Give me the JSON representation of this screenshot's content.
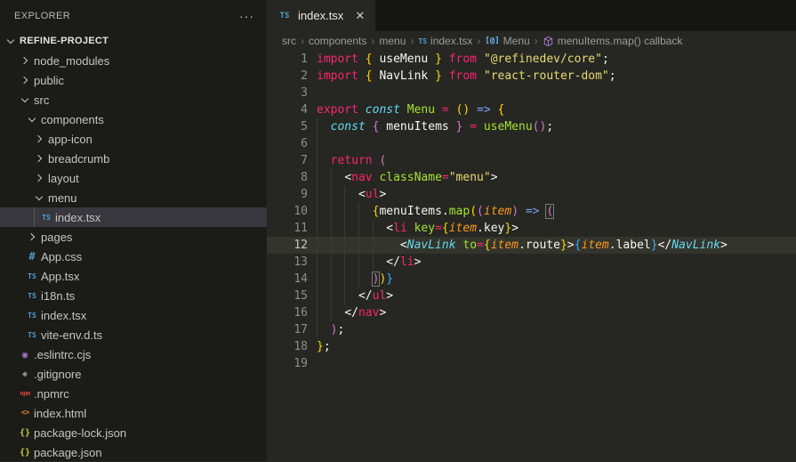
{
  "colors": {
    "editor_bg": "#262722",
    "sidebar_bg": "#1b1b18",
    "tabstrip_bg": "#161612",
    "selection_bg": "#37373d",
    "active_line_bg": "#33342c",
    "keyword": "#f92672",
    "entity": "#a6e22e",
    "type_italic": "#66d9ef",
    "param_italic": "#fd971f",
    "string": "#e6db74",
    "foreground": "#f8f8f2",
    "bracket1": "#ffd700",
    "bracket2": "#da70d6",
    "bracket3": "#3fa9ff",
    "ts_icon": "#4f9fd1"
  },
  "explorer": {
    "title": "EXPLORER",
    "more_label": "···",
    "root_label": "REFINE-PROJECT",
    "items": [
      {
        "label": "node_modules",
        "type": "folder",
        "state": "collapsed",
        "level": 1
      },
      {
        "label": "public",
        "type": "folder",
        "state": "collapsed",
        "level": 1
      },
      {
        "label": "src",
        "type": "folder",
        "state": "expanded",
        "level": 1
      },
      {
        "label": "components",
        "type": "folder",
        "state": "expanded",
        "level": 2
      },
      {
        "label": "app-icon",
        "type": "folder",
        "state": "collapsed",
        "level": 3
      },
      {
        "label": "breadcrumb",
        "type": "folder",
        "state": "collapsed",
        "level": 3
      },
      {
        "label": "layout",
        "type": "folder",
        "state": "collapsed",
        "level": 3
      },
      {
        "label": "menu",
        "type": "folder",
        "state": "expanded",
        "level": 3
      },
      {
        "label": "index.tsx",
        "type": "file",
        "icon": "ts",
        "level": 4,
        "selected": true
      },
      {
        "label": "pages",
        "type": "folder",
        "state": "collapsed",
        "level": 2
      },
      {
        "label": "App.css",
        "type": "file",
        "icon": "css",
        "level": 2
      },
      {
        "label": "App.tsx",
        "type": "file",
        "icon": "ts",
        "level": 2
      },
      {
        "label": "i18n.ts",
        "type": "file",
        "icon": "ts",
        "level": 2
      },
      {
        "label": "index.tsx",
        "type": "file",
        "icon": "ts",
        "level": 2
      },
      {
        "label": "vite-env.d.ts",
        "type": "file",
        "icon": "ts",
        "level": 2
      },
      {
        "label": ".eslintrc.cjs",
        "type": "file",
        "icon": "eslint",
        "level": 1
      },
      {
        "label": ".gitignore",
        "type": "file",
        "icon": "git",
        "level": 1
      },
      {
        "label": ".npmrc",
        "type": "file",
        "icon": "npm",
        "level": 1
      },
      {
        "label": "index.html",
        "type": "file",
        "icon": "html",
        "level": 1
      },
      {
        "label": "package-lock.json",
        "type": "file",
        "icon": "json",
        "level": 1
      },
      {
        "label": "package.json",
        "type": "file",
        "icon": "json",
        "level": 1
      }
    ],
    "file_icon_glyphs": {
      "ts": "TS",
      "css": "#",
      "json": "{}",
      "html": "<>",
      "eslint": "◉",
      "git": "◆",
      "npm": "npm"
    }
  },
  "tab": {
    "icon": "TS",
    "title": "index.tsx",
    "close": "✕"
  },
  "breadcrumb": {
    "separator": "›",
    "items": [
      {
        "label": "src"
      },
      {
        "label": "components"
      },
      {
        "label": "menu"
      },
      {
        "label": "index.tsx",
        "icon": "ts"
      },
      {
        "label": "Menu",
        "icon": "symbol-variable"
      },
      {
        "label": "menuItems.map() callback",
        "icon": "symbol-method"
      }
    ]
  },
  "editor": {
    "lines": [
      {
        "n": 1,
        "tokens": [
          [
            "import",
            "pink"
          ],
          [
            " ",
            "fg"
          ],
          [
            "{",
            "gold"
          ],
          [
            " useMenu ",
            "fg"
          ],
          [
            "}",
            "gold"
          ],
          [
            " ",
            "fg"
          ],
          [
            "from",
            "pink"
          ],
          [
            " ",
            "fg"
          ],
          [
            "\"@refinedev/core\"",
            "str"
          ],
          [
            ";",
            "fg"
          ]
        ]
      },
      {
        "n": 2,
        "tokens": [
          [
            "import",
            "pink"
          ],
          [
            " ",
            "fg"
          ],
          [
            "{",
            "gold"
          ],
          [
            " NavLink ",
            "fg"
          ],
          [
            "}",
            "gold"
          ],
          [
            " ",
            "fg"
          ],
          [
            "from",
            "pink"
          ],
          [
            " ",
            "fg"
          ],
          [
            "\"react-router-dom\"",
            "str"
          ],
          [
            ";",
            "fg"
          ]
        ]
      },
      {
        "n": 3,
        "tokens": []
      },
      {
        "n": 4,
        "tokens": [
          [
            "export",
            "pink"
          ],
          [
            " ",
            "fg"
          ],
          [
            "const",
            "cyan"
          ],
          [
            " ",
            "fg"
          ],
          [
            "Menu",
            "green"
          ],
          [
            " ",
            "fg"
          ],
          [
            "=",
            "pink"
          ],
          [
            " ",
            "fg"
          ],
          [
            "(",
            "gold"
          ],
          [
            ")",
            "gold"
          ],
          [
            " ",
            "fg"
          ],
          [
            "=>",
            "arrow"
          ],
          [
            " ",
            "fg"
          ],
          [
            "{",
            "gold"
          ]
        ]
      },
      {
        "n": 5,
        "tokens": [
          [
            "  ",
            "fg"
          ],
          [
            "const",
            "cyan"
          ],
          [
            " ",
            "fg"
          ],
          [
            "{",
            "orchid"
          ],
          [
            " menuItems ",
            "fg"
          ],
          [
            "}",
            "orchid"
          ],
          [
            " ",
            "fg"
          ],
          [
            "=",
            "pink"
          ],
          [
            " ",
            "fg"
          ],
          [
            "useMenu",
            "green"
          ],
          [
            "(",
            "orchid"
          ],
          [
            ")",
            "orchid"
          ],
          [
            ";",
            "fg"
          ]
        ]
      },
      {
        "n": 6,
        "tokens": []
      },
      {
        "n": 7,
        "tokens": [
          [
            "  ",
            "fg"
          ],
          [
            "return",
            "pink"
          ],
          [
            " ",
            "fg"
          ],
          [
            "(",
            "orchid"
          ]
        ]
      },
      {
        "n": 8,
        "tokens": [
          [
            "    ",
            "fg"
          ],
          [
            "<",
            "fg"
          ],
          [
            "nav",
            "pink"
          ],
          [
            " ",
            "fg"
          ],
          [
            "className",
            "green"
          ],
          [
            "=",
            "pink"
          ],
          [
            "\"menu\"",
            "str"
          ],
          [
            ">",
            "fg"
          ]
        ]
      },
      {
        "n": 9,
        "tokens": [
          [
            "      ",
            "fg"
          ],
          [
            "<",
            "fg"
          ],
          [
            "ul",
            "pink"
          ],
          [
            ">",
            "fg"
          ]
        ]
      },
      {
        "n": 10,
        "tokens": [
          [
            "        ",
            "fg"
          ],
          [
            "{",
            "gold"
          ],
          [
            "menuItems",
            "fg"
          ],
          [
            ".",
            "fg"
          ],
          [
            "map",
            "green"
          ],
          [
            "(",
            "gold"
          ],
          [
            "(",
            "orchid"
          ],
          [
            "item",
            "orange"
          ],
          [
            ")",
            "orchid"
          ],
          [
            " ",
            "fg"
          ],
          [
            "=>",
            "arrow"
          ],
          [
            " ",
            "fg"
          ],
          [
            "(",
            "orchid",
            "box"
          ]
        ]
      },
      {
        "n": 11,
        "tokens": [
          [
            "          ",
            "fg"
          ],
          [
            "<",
            "fg"
          ],
          [
            "li",
            "pink"
          ],
          [
            " ",
            "fg"
          ],
          [
            "key",
            "green"
          ],
          [
            "=",
            "pink"
          ],
          [
            "{",
            "gold"
          ],
          [
            "item",
            "orange"
          ],
          [
            ".key",
            "fg"
          ],
          [
            "}",
            "gold"
          ],
          [
            ">",
            "fg"
          ]
        ]
      },
      {
        "n": 12,
        "active": true,
        "tokens": [
          [
            "            ",
            "fg"
          ],
          [
            "<",
            "fg"
          ],
          [
            "NavLink",
            "cyan"
          ],
          [
            " ",
            "fg"
          ],
          [
            "to",
            "green"
          ],
          [
            "=",
            "pink"
          ],
          [
            "{",
            "gold"
          ],
          [
            "item",
            "orange"
          ],
          [
            ".route",
            "fg"
          ],
          [
            "}",
            "gold"
          ],
          [
            ">",
            "fg"
          ],
          [
            "{",
            "blue"
          ],
          [
            "item",
            "orange"
          ],
          [
            ".label",
            "fg"
          ],
          [
            "}",
            "blue"
          ],
          [
            "</",
            "fg"
          ],
          [
            "NavLink",
            "cyan"
          ],
          [
            ">",
            "fg"
          ]
        ]
      },
      {
        "n": 13,
        "tokens": [
          [
            "          ",
            "fg"
          ],
          [
            "</",
            "fg"
          ],
          [
            "li",
            "pink"
          ],
          [
            ">",
            "fg"
          ]
        ]
      },
      {
        "n": 14,
        "tokens": [
          [
            "        ",
            "fg"
          ],
          [
            ")",
            "orchid",
            "box"
          ],
          [
            ")",
            "gold"
          ],
          [
            "}",
            "blue"
          ]
        ]
      },
      {
        "n": 15,
        "tokens": [
          [
            "      ",
            "fg"
          ],
          [
            "</",
            "fg"
          ],
          [
            "ul",
            "pink"
          ],
          [
            ">",
            "fg"
          ]
        ]
      },
      {
        "n": 16,
        "tokens": [
          [
            "    ",
            "fg"
          ],
          [
            "</",
            "fg"
          ],
          [
            "nav",
            "pink"
          ],
          [
            ">",
            "fg"
          ]
        ]
      },
      {
        "n": 17,
        "tokens": [
          [
            "  ",
            "fg"
          ],
          [
            ")",
            "orchid"
          ],
          [
            ";",
            "fg"
          ]
        ]
      },
      {
        "n": 18,
        "tokens": [
          [
            "}",
            "gold"
          ],
          [
            ";",
            "fg"
          ]
        ]
      },
      {
        "n": 19,
        "tokens": []
      }
    ]
  }
}
